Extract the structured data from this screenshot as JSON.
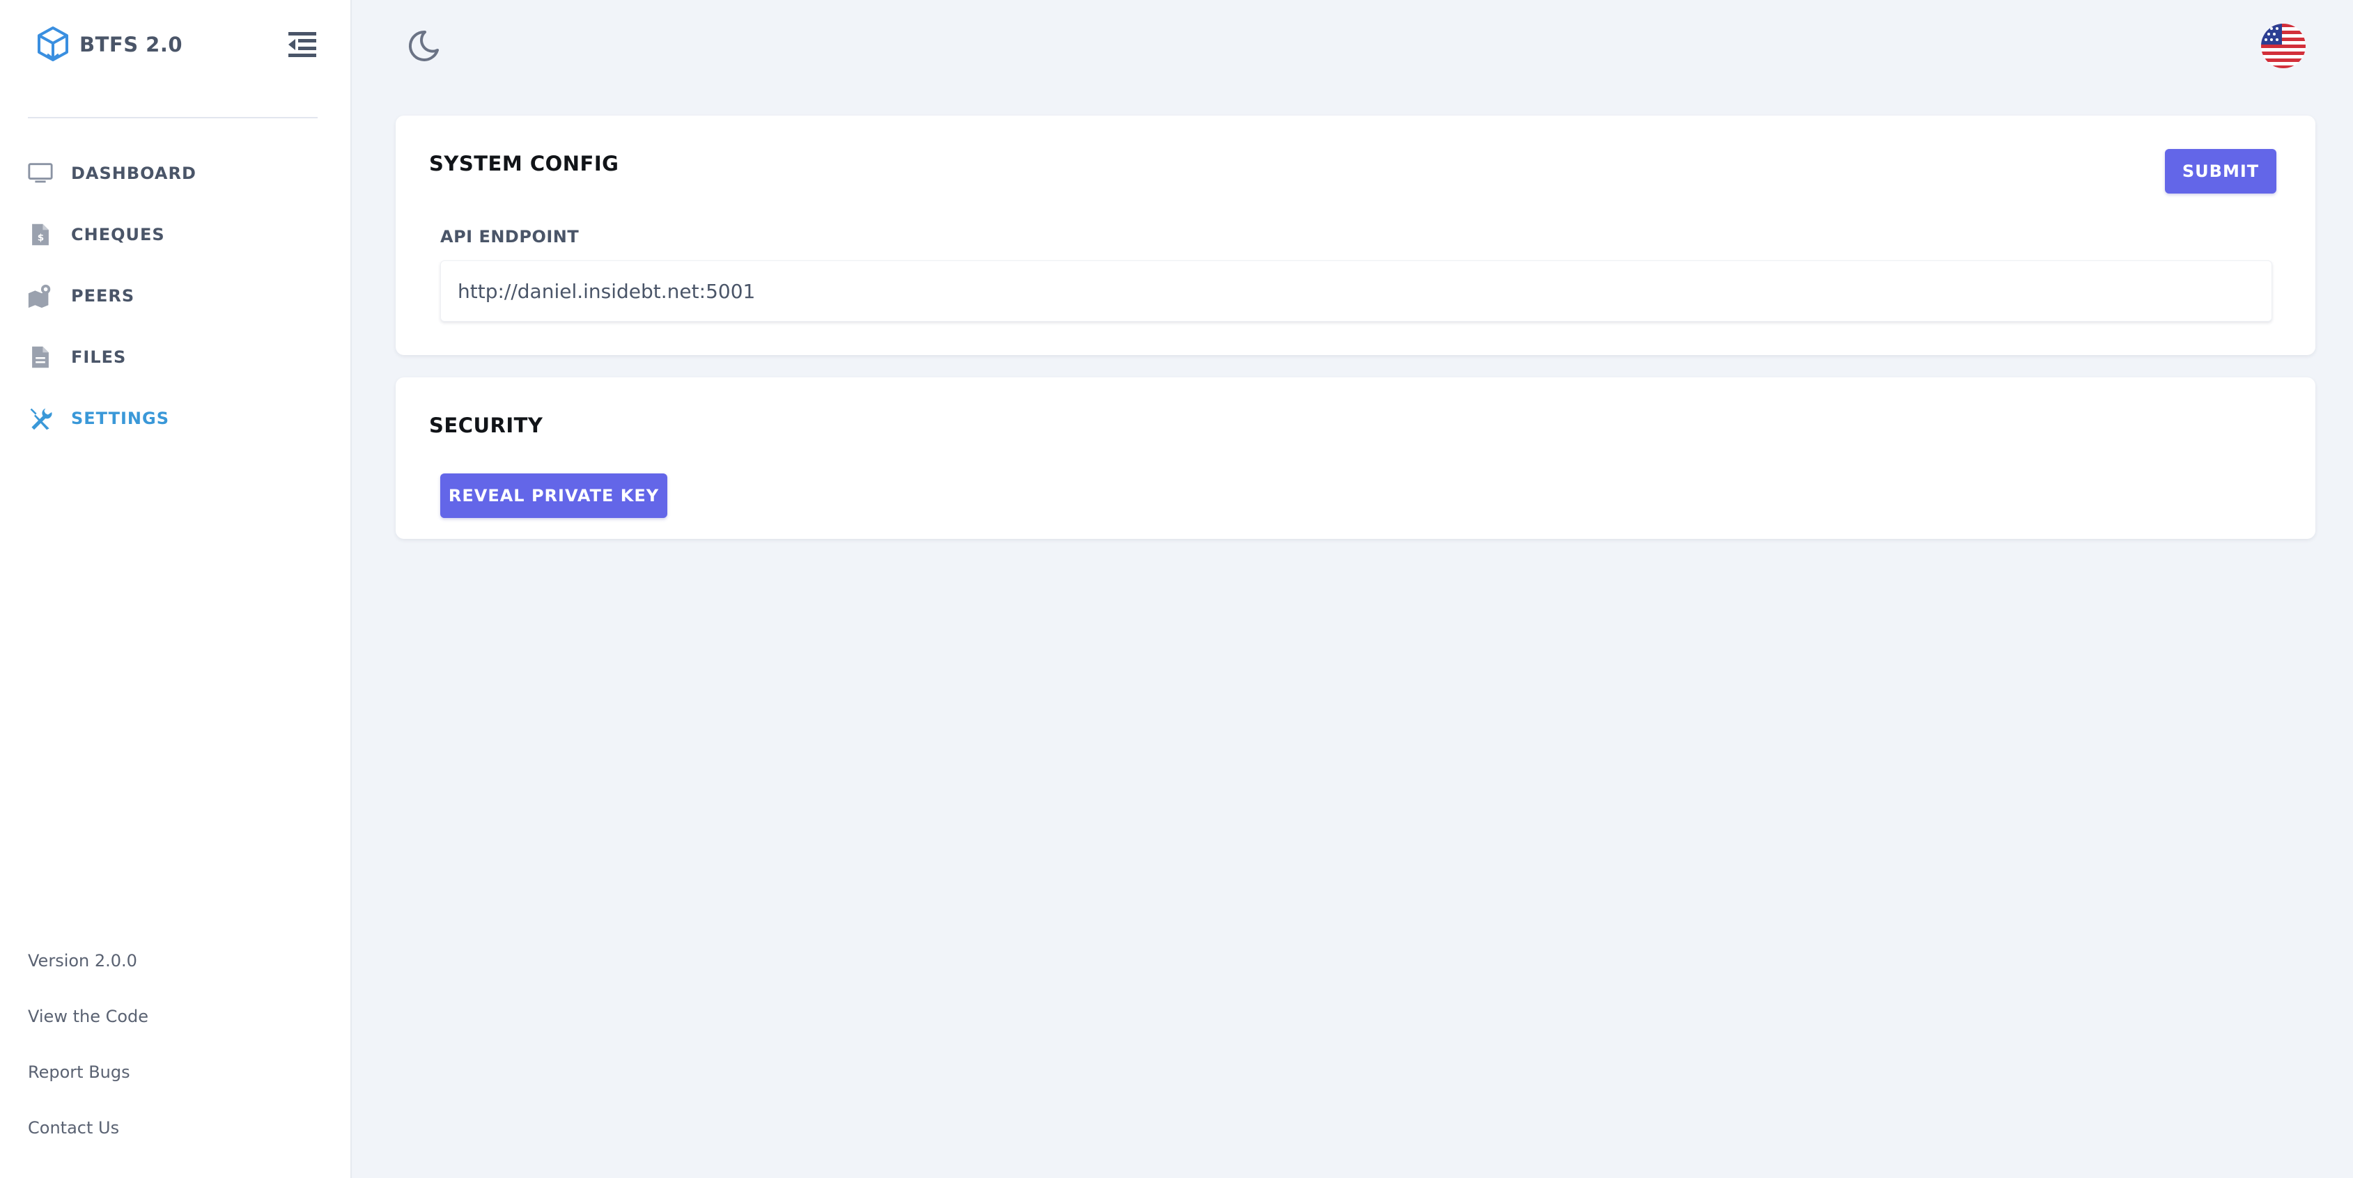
{
  "brand": {
    "name": "BTFS 2.0"
  },
  "sidebar": {
    "items": [
      {
        "label": "DASHBOARD",
        "icon": "monitor-icon"
      },
      {
        "label": "CHEQUES",
        "icon": "cheque-document-icon"
      },
      {
        "label": "PEERS",
        "icon": "peers-map-icon"
      },
      {
        "label": "FILES",
        "icon": "file-icon"
      },
      {
        "label": "SETTINGS",
        "icon": "tools-icon",
        "active": true
      }
    ],
    "footer": {
      "version": "Version 2.0.0",
      "view_code": "View the Code",
      "report_bugs": "Report Bugs",
      "contact": "Contact Us"
    }
  },
  "system_config": {
    "title": "SYSTEM CONFIG",
    "submit_label": "SUBMIT",
    "api_endpoint_label": "API ENDPOINT",
    "api_endpoint_value": "http://daniel.insidebt.net:5001"
  },
  "security": {
    "title": "SECURITY",
    "reveal_label": "REVEAL PRIVATE KEY"
  },
  "colors": {
    "accent": "#6366e8",
    "active_nav": "#3a98d8",
    "background": "#f1f4f9"
  }
}
